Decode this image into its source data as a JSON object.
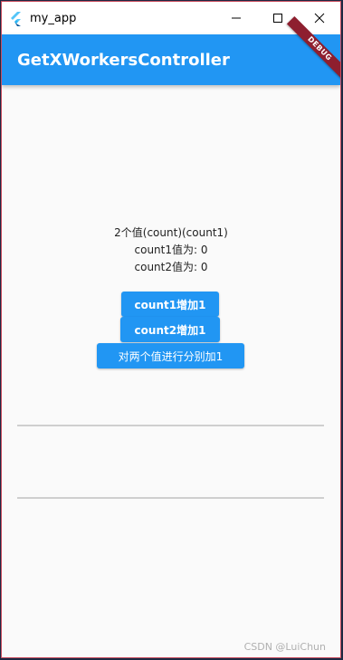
{
  "window": {
    "title": "my_app",
    "icon": "flutter-logo-icon",
    "minimize_icon": "minimize-icon",
    "maximize_icon": "maximize-icon",
    "close_icon": "close-icon"
  },
  "appbar": {
    "title": "GetXWorkersController",
    "background": "#2196f3",
    "debug_banner": "DEBUG"
  },
  "content": {
    "description": "2个值(count)(count1)",
    "count1_line": "count1值为: 0",
    "count2_line": "count2值为: 0"
  },
  "buttons": {
    "count1_increment": "count1增加1",
    "count2_increment": "count2增加1",
    "both_increment": "对两个值进行分别加1"
  },
  "watermark": "CSDN @LuiChun"
}
